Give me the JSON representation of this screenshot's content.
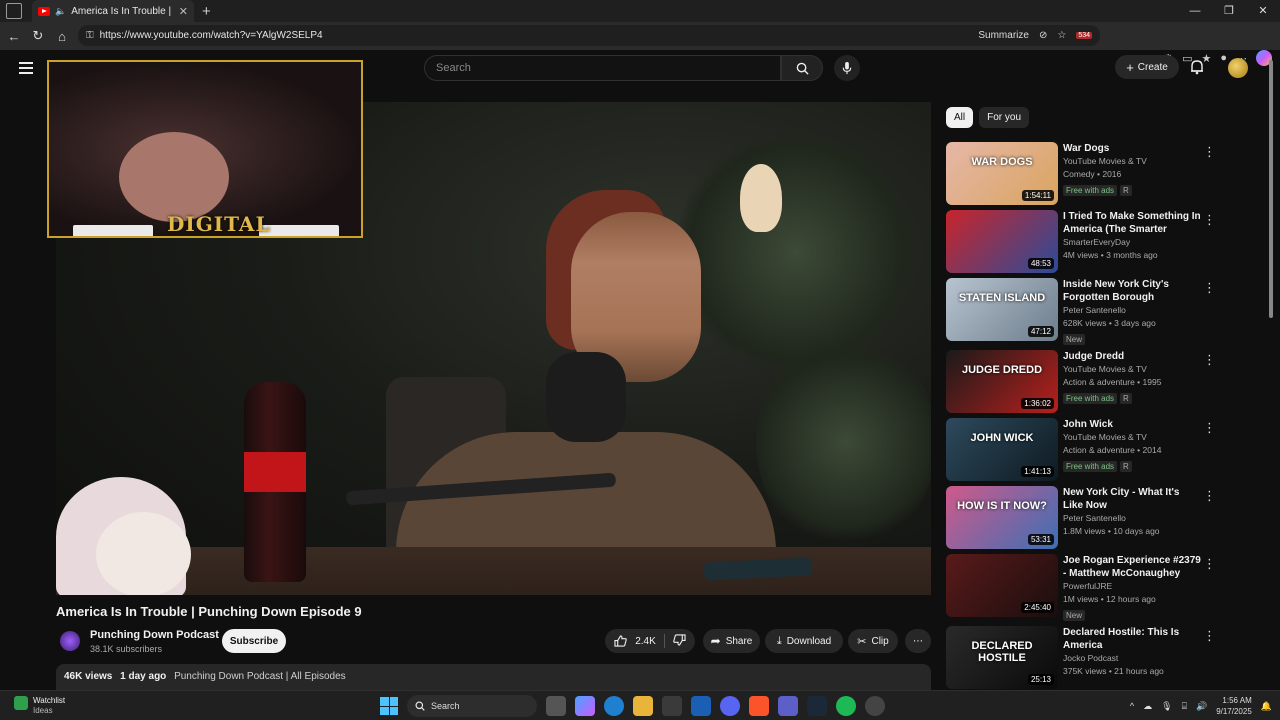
{
  "browser": {
    "tab_title": "America Is In Trouble | Punc...",
    "url": "https://www.youtube.com/watch?v=YAlgW2SELP4",
    "summarize_label": "Summarize",
    "ext_badge": "534"
  },
  "header": {
    "search_placeholder": "Search",
    "create_label": "Create"
  },
  "facecam": {
    "logo_text": "DIGITAL"
  },
  "video": {
    "title": "America Is In Trouble | Punching Down Episode 9",
    "channel": "Punching Down Podcast",
    "subscribers": "38.1K subscribers",
    "subscribe_label": "Subscribe",
    "likes": "2.4K",
    "share_label": "Share",
    "download_label": "Download",
    "clip_label": "Clip",
    "views": "46K views",
    "age": "1 day ago",
    "tags": "Punching Down Podcast | All Episodes"
  },
  "chips": [
    "All",
    "For you"
  ],
  "recommendations": [
    {
      "title": "War Dogs",
      "channel": "YouTube Movies & TV",
      "meta": "Comedy • 2016",
      "badges": [
        "Free with ads",
        "R"
      ],
      "duration": "1:54:11",
      "thumb_text": "WAR DOGS",
      "colors": [
        "#e6b7a8",
        "#d9a45f"
      ]
    },
    {
      "title": "I Tried To Make Something In America (The Smarter Scrubb...",
      "channel": "SmarterEveryDay",
      "meta": "4M views • 3 months ago",
      "badges": [],
      "duration": "48:53",
      "thumb_text": "",
      "colors": [
        "#c9242a",
        "#2a4c9a"
      ]
    },
    {
      "title": "Inside New York City's Forgotten Borough",
      "channel": "Peter Santenello",
      "meta": "628K views • 3 days ago",
      "badges": [
        "New"
      ],
      "duration": "47:12",
      "thumb_text": "STATEN ISLAND",
      "colors": [
        "#b8c4d0",
        "#6d7d8c"
      ]
    },
    {
      "title": "Judge Dredd",
      "channel": "YouTube Movies & TV",
      "meta": "Action & adventure • 1995",
      "badges": [
        "Free with ads",
        "R"
      ],
      "duration": "1:36:02",
      "thumb_text": "JUDGE DREDD",
      "colors": [
        "#1a1a1a",
        "#b8201c"
      ]
    },
    {
      "title": "John Wick",
      "channel": "YouTube Movies & TV",
      "meta": "Action & adventure • 2014",
      "badges": [
        "Free with ads",
        "R"
      ],
      "duration": "1:41:13",
      "thumb_text": "JOHN WICK",
      "colors": [
        "#2d4a5c",
        "#0e1a22"
      ]
    },
    {
      "title": "New York City - What It's Like Now",
      "channel": "Peter Santenello",
      "meta": "1.8M views • 10 days ago",
      "badges": [],
      "duration": "53:31",
      "thumb_text": "HOW IS IT NOW?",
      "colors": [
        "#d05a8a",
        "#3c6fb5"
      ]
    },
    {
      "title": "Joe Rogan Experience #2379 - Matthew McConaughey",
      "channel": "PowerfulJRE",
      "meta": "1M views • 12 hours ago",
      "badges": [
        "New"
      ],
      "duration": "2:45:40",
      "thumb_text": "",
      "colors": [
        "#5a1a1a",
        "#1a0e0e"
      ]
    },
    {
      "title": "Declared Hostile: This Is America",
      "channel": "Jocko Podcast",
      "meta": "375K views • 21 hours ago",
      "badges": [],
      "duration": "25:13",
      "thumb_text": "DECLARED HOSTILE",
      "colors": [
        "#2a2a2a",
        "#0a0a0a"
      ]
    }
  ],
  "taskbar": {
    "widget_title": "Watchlist",
    "widget_sub": "Ideas",
    "search_label": "Search",
    "time": "1:56 AM",
    "date": "9/17/2025"
  }
}
